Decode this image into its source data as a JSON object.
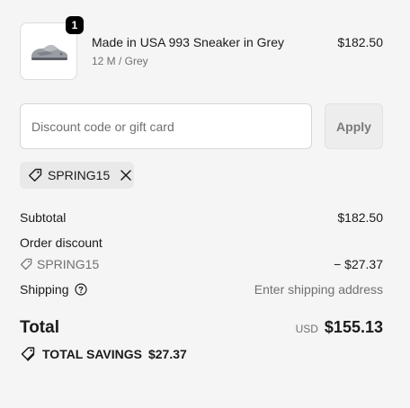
{
  "line_item": {
    "quantity": "1",
    "title": "Made in USA 993 Sneaker in Grey",
    "variant": "12 M / Grey",
    "price": "$182.50",
    "image_alt": "grey sneaker"
  },
  "discount": {
    "placeholder": "Discount code or gift card",
    "value": "",
    "apply_label": "Apply",
    "applied_code": "SPRING15"
  },
  "summary": {
    "subtotal_label": "Subtotal",
    "subtotal_value": "$182.50",
    "order_discount_label": "Order discount",
    "discount_code": "SPRING15",
    "discount_value": "− $27.37",
    "shipping_label": "Shipping",
    "shipping_value": "Enter shipping address"
  },
  "total": {
    "label": "Total",
    "currency": "USD",
    "amount": "$155.13"
  },
  "savings": {
    "label": "TOTAL SAVINGS",
    "amount": "$27.37"
  },
  "colors": {
    "background": "#f5f5f5",
    "text": "#1a1a1a",
    "muted": "#707070",
    "badge": "#000000",
    "button_disabled": "#ededed"
  },
  "icons": {
    "tag": "tag-icon",
    "remove": "close-icon",
    "info": "question-circle-icon",
    "savings": "tags-icon"
  }
}
